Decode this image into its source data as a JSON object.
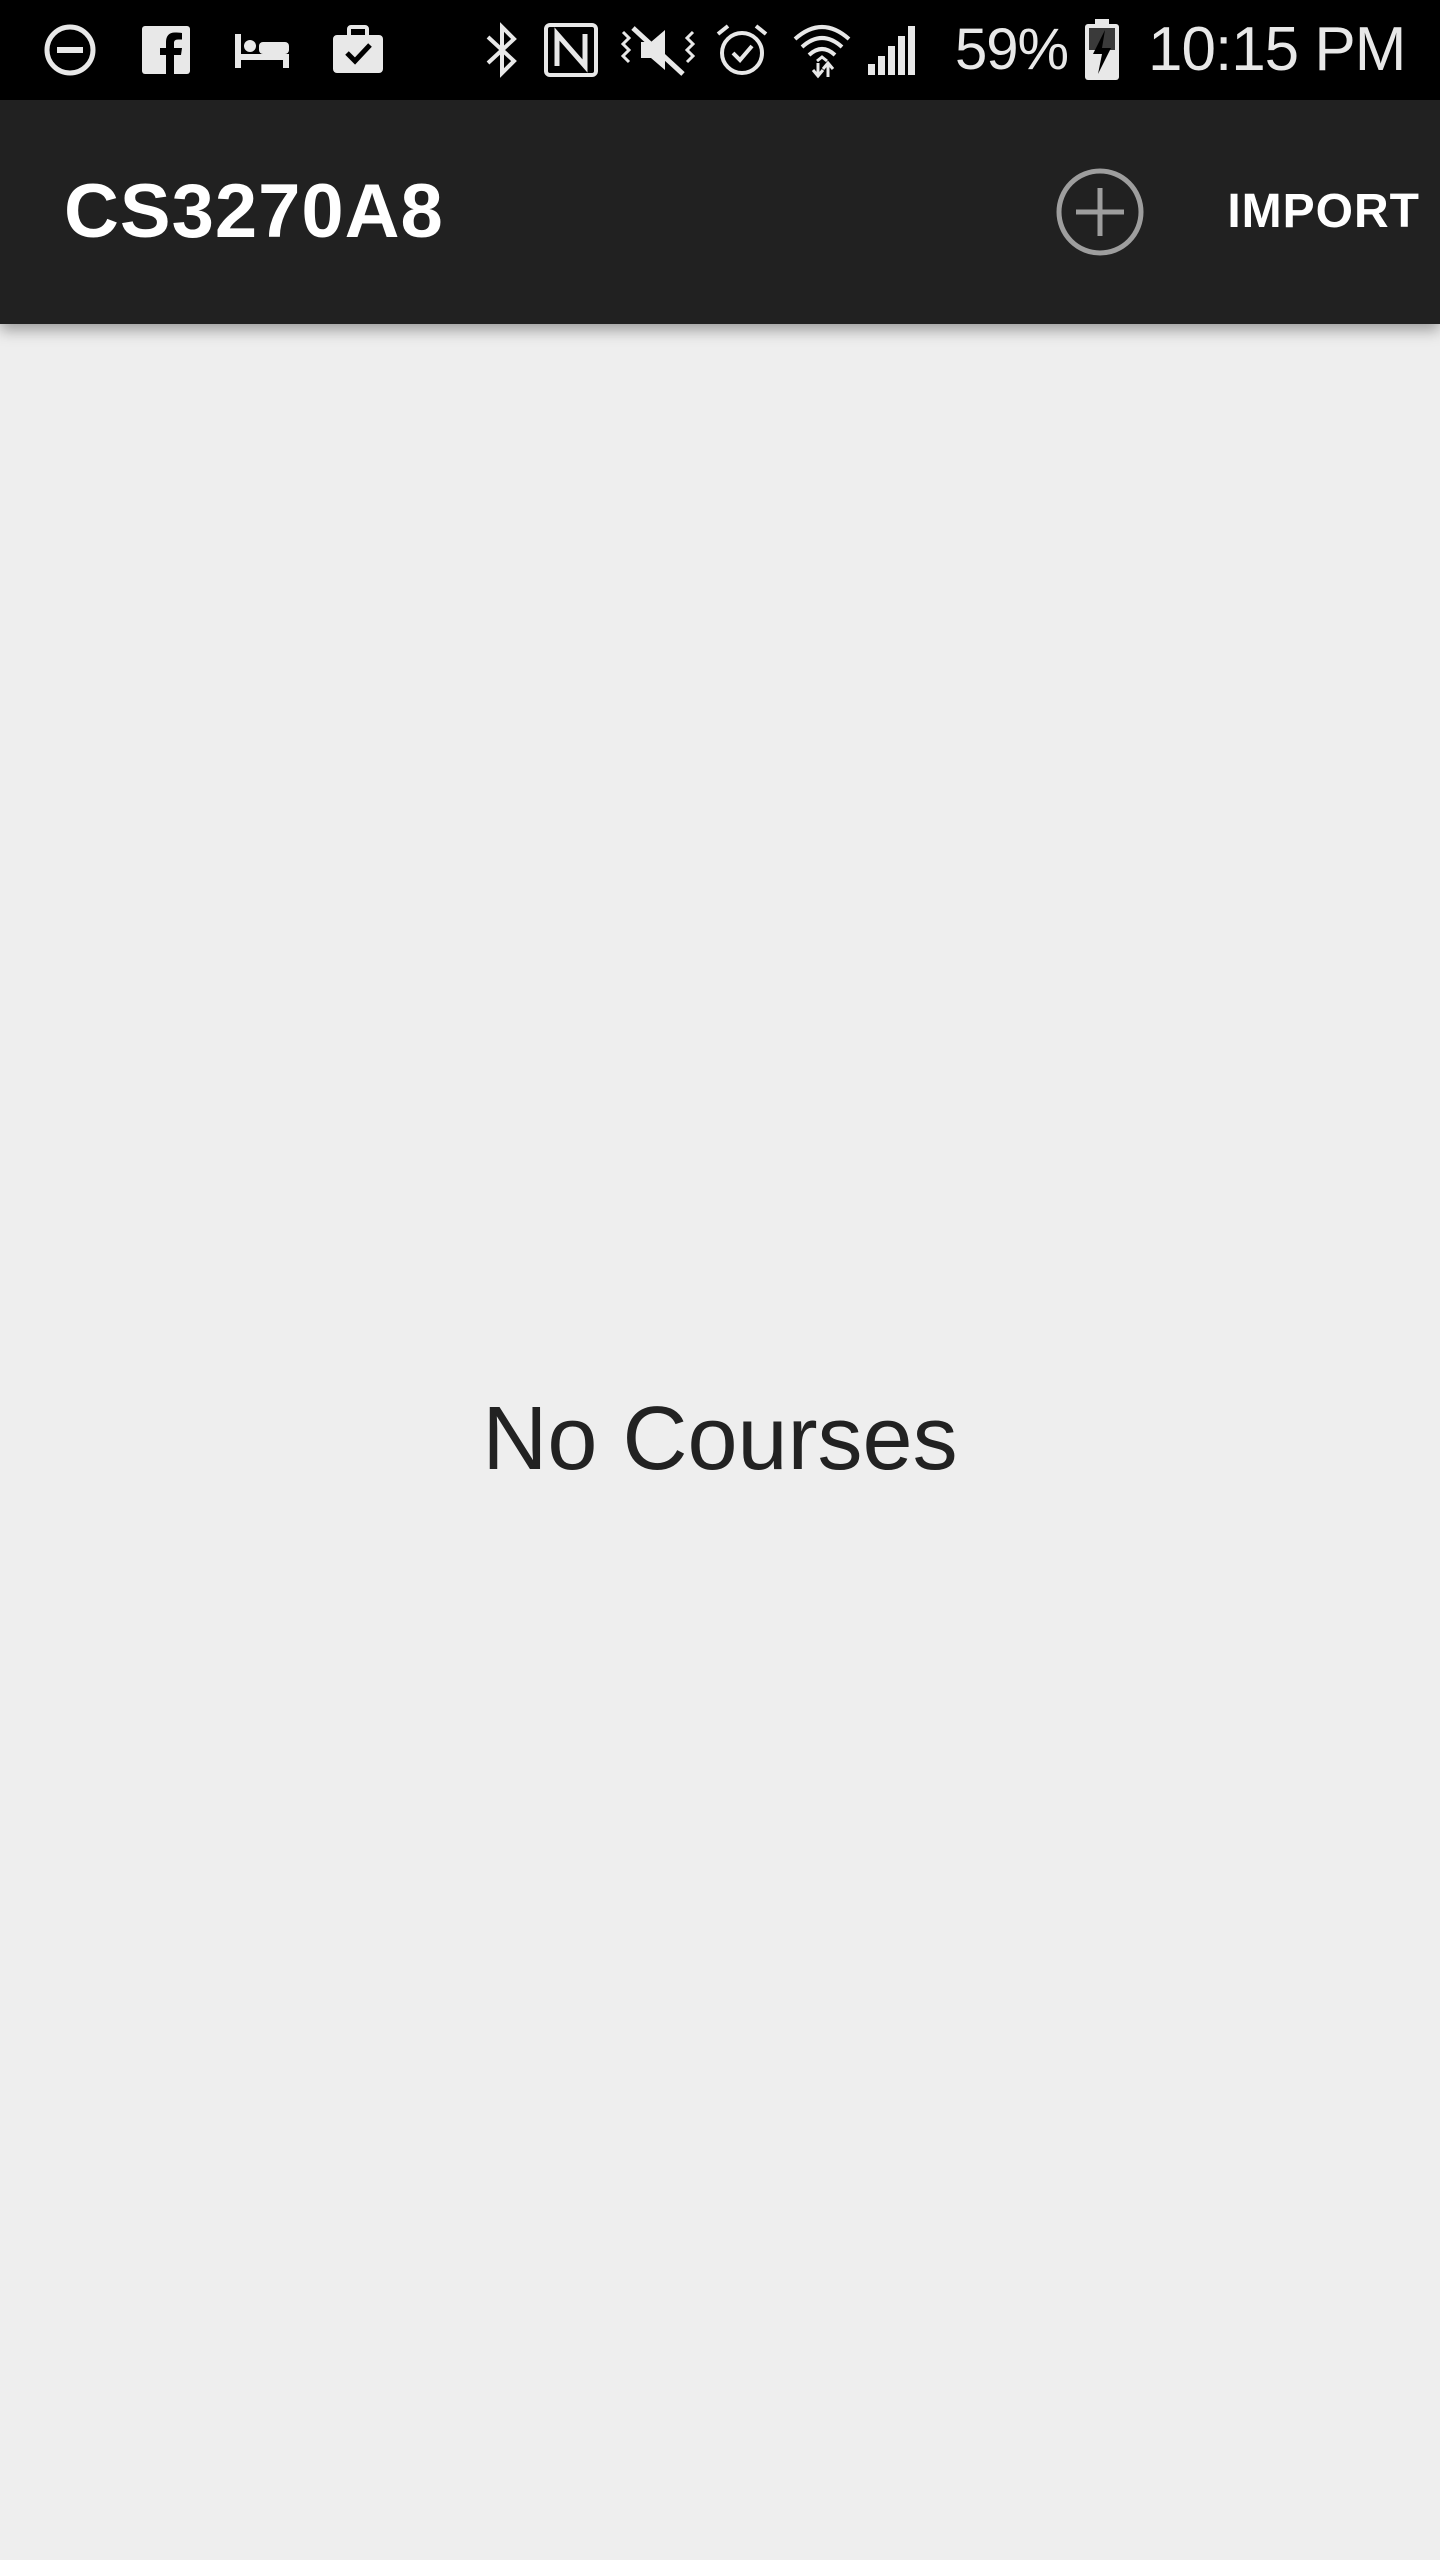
{
  "status_bar": {
    "battery_percent": "59%",
    "time": "10:15 PM",
    "left_icons": [
      "do-not-disturb-icon",
      "facebook-icon",
      "bed-icon",
      "briefcase-check-icon"
    ],
    "right_icons": [
      "bluetooth-icon",
      "nfc-icon",
      "vibrate-mute-icon",
      "alarm-icon",
      "wifi-icon",
      "signal-icon",
      "battery-charging-icon"
    ]
  },
  "app_bar": {
    "title": "CS3270A8",
    "add_icon": "add-circle-icon",
    "import_label": "IMPORT",
    "background": "#212121"
  },
  "main": {
    "empty_message": "No Courses",
    "background": "#eeeeee"
  }
}
